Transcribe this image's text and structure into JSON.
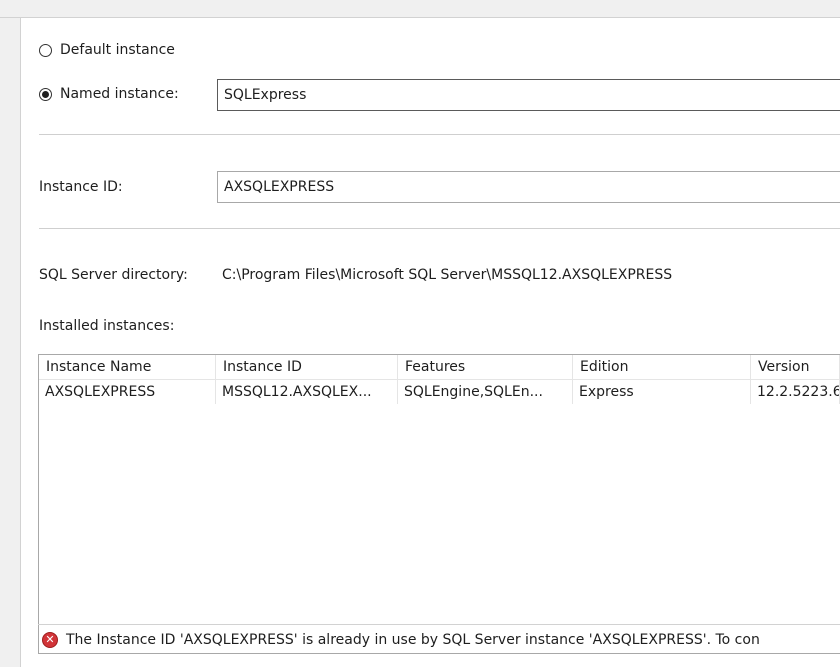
{
  "instance_choice": {
    "default_label": "Default instance",
    "named_label": "Named instance:",
    "named_value": "SQLExpress",
    "selected": "named"
  },
  "instance_id": {
    "label": "Instance ID:",
    "value": "AXSQLEXPRESS"
  },
  "directory": {
    "label": "SQL Server directory:",
    "value": "C:\\Program Files\\Microsoft SQL Server\\MSSQL12.AXSQLEXPRESS"
  },
  "installed": {
    "label": "Installed instances:",
    "columns": [
      "Instance Name",
      "Instance ID",
      "Features",
      "Edition",
      "Version"
    ],
    "rows": [
      [
        "AXSQLEXPRESS",
        "MSSQL12.AXSQLEX...",
        "SQLEngine,SQLEn...",
        "Express",
        "12.2.5223.6"
      ]
    ]
  },
  "status": {
    "icon": "error-icon",
    "icon_glyph": "✕",
    "message": "The Instance ID 'AXSQLEXPRESS' is already in use by SQL Server instance 'AXSQLEXPRESS'. To con"
  }
}
